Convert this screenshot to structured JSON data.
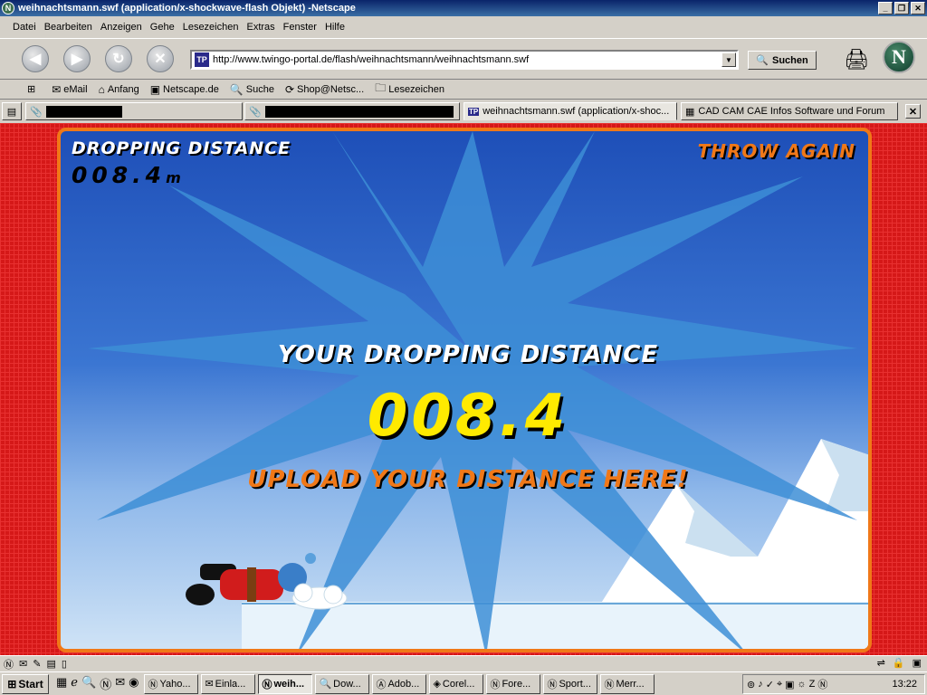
{
  "window": {
    "title": "weihnachtsmann.swf (application/x-shockwave-flash Objekt) -Netscape",
    "app_icon": "netscape-icon",
    "controls": [
      "minimize",
      "maximize",
      "close"
    ]
  },
  "menu": [
    "Datei",
    "Bearbeiten",
    "Anzeigen",
    "Gehe",
    "Lesezeichen",
    "Extras",
    "Fenster",
    "Hilfe"
  ],
  "navigation": {
    "url": "http://www.twingo-portal.de/flash/weihnachtsmann/weihnachtsmann.swf",
    "search_label": "Suchen",
    "site_icon_text": "TP",
    "logo_text": "N"
  },
  "personal_toolbar": [
    {
      "label": "eMail",
      "icon": "mail-icon"
    },
    {
      "label": "Anfang",
      "icon": "home-icon"
    },
    {
      "label": "Netscape.de",
      "icon": "my-icon"
    },
    {
      "label": "Suche",
      "icon": "search-icon"
    },
    {
      "label": "Shop@Netsc...",
      "icon": "shop-icon"
    },
    {
      "label": "Lesezeichen",
      "icon": "folder-icon"
    }
  ],
  "tabs": [
    {
      "label": "",
      "redacted": true,
      "active": false
    },
    {
      "label": "",
      "redacted": true,
      "active": false
    },
    {
      "label": "weihnachtsmann.swf (application/x-shoc...",
      "active": true
    },
    {
      "label": "CAD CAM CAE Infos Software und Forum",
      "active": false
    }
  ],
  "game": {
    "dropping_distance_label": "DROPPING DISTANCE",
    "distance_small": "008.4",
    "distance_unit": "m",
    "throw_again": "THROW AGAIN",
    "your_distance_label": "YOUR DROPPING DISTANCE",
    "distance_big": "008.4",
    "upload_label": "UPLOAD YOUR DISTANCE HERE!",
    "colors": {
      "accent_orange": "#f07818",
      "score_yellow": "#ffea00",
      "frame_red": "#d51818",
      "sky_blue": "#3b76d2"
    }
  },
  "taskbar": {
    "start_label": "Start",
    "buttons": [
      {
        "label": "Yaho...",
        "active": false
      },
      {
        "label": "Einla...",
        "active": false
      },
      {
        "label": "weih...",
        "active": true
      },
      {
        "label": "Dow...",
        "active": false
      },
      {
        "label": "Adob...",
        "active": false
      },
      {
        "label": "Corel...",
        "active": false
      },
      {
        "label": "Fore...",
        "active": false
      },
      {
        "label": "Sport...",
        "active": false
      },
      {
        "label": "Merr...",
        "active": false
      }
    ],
    "clock": "13:22"
  }
}
